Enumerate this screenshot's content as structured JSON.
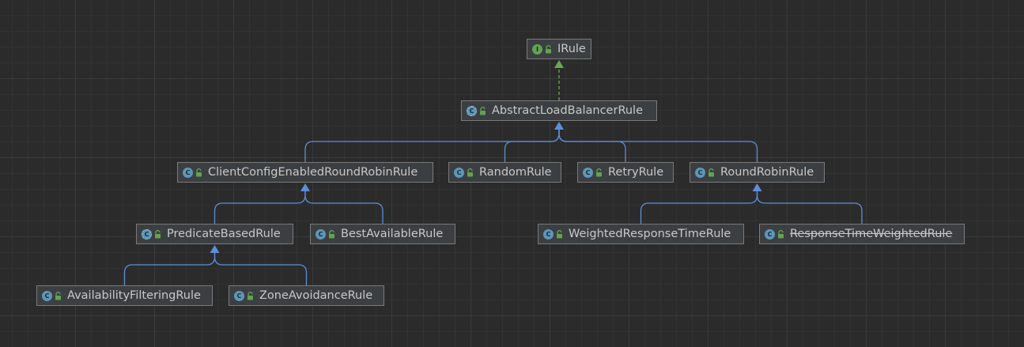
{
  "nodes": [
    {
      "id": "irule",
      "label": "IRule",
      "kind": "interface",
      "badge": "I",
      "deprecated": false
    },
    {
      "id": "abstract_lb",
      "label": "AbstractLoadBalancerRule",
      "kind": "abstract",
      "badge": "C",
      "deprecated": false
    },
    {
      "id": "client_config",
      "label": "ClientConfigEnabledRoundRobinRule",
      "kind": "class",
      "badge": "C",
      "deprecated": false
    },
    {
      "id": "random",
      "label": "RandomRule",
      "kind": "class",
      "badge": "C",
      "deprecated": false
    },
    {
      "id": "retry",
      "label": "RetryRule",
      "kind": "class",
      "badge": "C",
      "deprecated": false
    },
    {
      "id": "round_robin",
      "label": "RoundRobinRule",
      "kind": "class",
      "badge": "C",
      "deprecated": false
    },
    {
      "id": "predicate",
      "label": "PredicateBasedRule",
      "kind": "abstract",
      "badge": "C",
      "deprecated": false
    },
    {
      "id": "best_available",
      "label": "BestAvailableRule",
      "kind": "class",
      "badge": "C",
      "deprecated": false
    },
    {
      "id": "weighted",
      "label": "WeightedResponseTimeRule",
      "kind": "class",
      "badge": "C",
      "deprecated": false
    },
    {
      "id": "response_time",
      "label": "ResponseTimeWeightedRule",
      "kind": "class",
      "badge": "C",
      "deprecated": true
    },
    {
      "id": "availability",
      "label": "AvailabilityFilteringRule",
      "kind": "class",
      "badge": "C",
      "deprecated": false
    },
    {
      "id": "zone",
      "label": "ZoneAvoidanceRule",
      "kind": "class",
      "badge": "C",
      "deprecated": false
    }
  ],
  "edges": [
    {
      "from": "abstract_lb",
      "to": "irule",
      "type": "implements"
    },
    {
      "from": "client_config",
      "to": "abstract_lb",
      "type": "extends"
    },
    {
      "from": "random",
      "to": "abstract_lb",
      "type": "extends"
    },
    {
      "from": "retry",
      "to": "abstract_lb",
      "type": "extends"
    },
    {
      "from": "round_robin",
      "to": "abstract_lb",
      "type": "extends"
    },
    {
      "from": "predicate",
      "to": "client_config",
      "type": "extends"
    },
    {
      "from": "best_available",
      "to": "client_config",
      "type": "extends"
    },
    {
      "from": "weighted",
      "to": "round_robin",
      "type": "extends"
    },
    {
      "from": "response_time",
      "to": "round_robin",
      "type": "extends"
    },
    {
      "from": "availability",
      "to": "predicate",
      "type": "extends"
    },
    {
      "from": "zone",
      "to": "predicate",
      "type": "extends"
    }
  ],
  "colors": {
    "background": "#2b2b2b",
    "node_fill": "#3c3f41",
    "node_border": "#7a7a7a",
    "text": "#c8c8c8",
    "extends_line": "#5c8fd6",
    "implements_line": "#6aa84f",
    "class_badge": "#5d97b9",
    "interface_badge": "#62a352",
    "lock_icon": "#62a352"
  }
}
